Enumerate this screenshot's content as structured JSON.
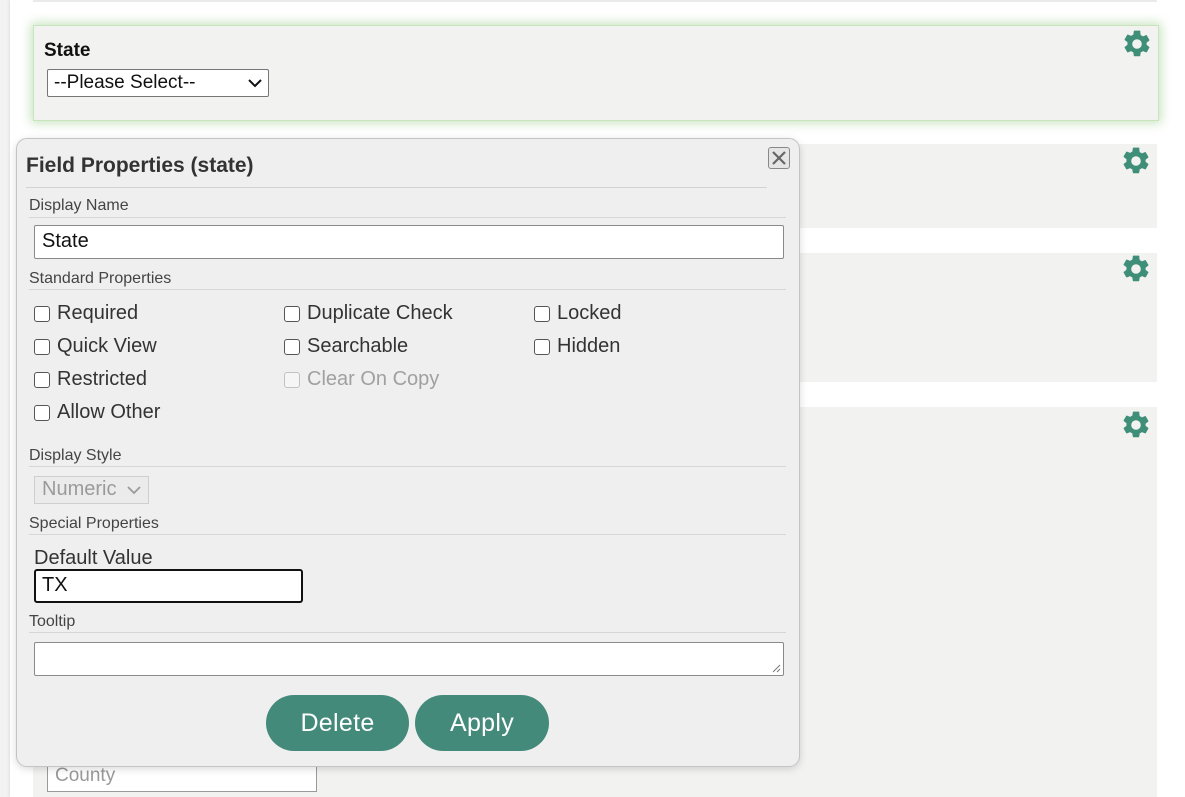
{
  "colors": {
    "accent": "#438a7b",
    "gear": "#3f8e78",
    "selected_glow": "#9fd08a"
  },
  "form": {
    "state_label": "State",
    "state_select_value": "--Please Select--",
    "county_placeholder": "County"
  },
  "dialog": {
    "title": "Field Properties (state)",
    "display_name_label": "Display Name",
    "display_name_value": "State",
    "standard_label": "Standard Properties",
    "checkboxes": {
      "required": "Required",
      "duplicate_check": "Duplicate Check",
      "locked": "Locked",
      "quick_view": "Quick View",
      "searchable": "Searchable",
      "hidden": "Hidden",
      "restricted": "Restricted",
      "clear_on_copy": "Clear On Copy",
      "allow_other": "Allow Other"
    },
    "display_style_label": "Display Style",
    "display_style_value": "Numeric",
    "special_label": "Special Properties",
    "default_value_label": "Default Value",
    "default_value": "TX",
    "tooltip_label": "Tooltip",
    "tooltip_value": "",
    "delete_label": "Delete",
    "apply_label": "Apply"
  },
  "icons": {
    "gear": "gear-icon",
    "close": "close-icon",
    "chevron": "chevron-down-icon"
  }
}
